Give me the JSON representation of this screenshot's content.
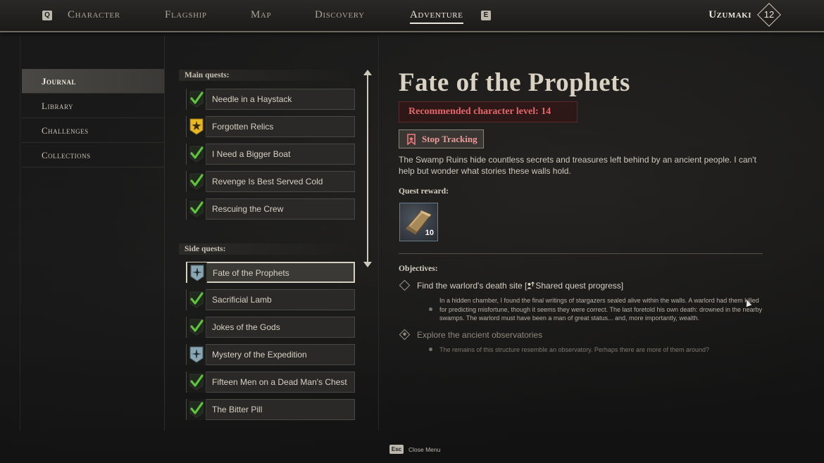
{
  "nav": {
    "left_key": "Q",
    "right_key": "E",
    "items": [
      {
        "label": "Character"
      },
      {
        "label": "Flagship"
      },
      {
        "label": "Map"
      },
      {
        "label": "Discovery"
      },
      {
        "label": "Adventure"
      }
    ],
    "active": "Adventure",
    "username": "Uzumaki",
    "level": "12"
  },
  "categories": {
    "items": [
      "Journal",
      "Library",
      "Challenges",
      "Collections"
    ],
    "active": "Journal"
  },
  "quests": {
    "main_label": "Main quests:",
    "main": [
      {
        "label": "Needle in a Haystack",
        "icon": "checkmark-icon"
      },
      {
        "label": "Forgotten Relics",
        "icon": "gold-star-icon"
      },
      {
        "label": "I Need a Bigger Boat",
        "icon": "checkmark-icon"
      },
      {
        "label": "Revenge Is Best Served Cold",
        "icon": "checkmark-icon"
      },
      {
        "label": "Rescuing the Crew",
        "icon": "checkmark-icon"
      }
    ],
    "side_label": "Side quests:",
    "side": [
      {
        "label": "Fate of the Prophets",
        "icon": "compass-star-icon"
      },
      {
        "label": "Sacrificial Lamb",
        "icon": "checkmark-icon"
      },
      {
        "label": "Jokes of the Gods",
        "icon": "checkmark-icon"
      },
      {
        "label": "Mystery of the Expedition",
        "icon": "compass-star-icon"
      },
      {
        "label": "Fifteen Men on a Dead Man's Chest",
        "icon": "checkmark-icon"
      },
      {
        "label": "The Bitter Pill",
        "icon": "checkmark-icon"
      }
    ],
    "selected": "Fate of the Prophets"
  },
  "detail": {
    "title": "Fate of the Prophets",
    "recommended_level": "Recommended character level: 14",
    "track_label": "Stop Tracking",
    "description": "The Swamp Ruins hide countless secrets and treasures left behind by an ancient people. I can't help but wonder what stories these walls hold.",
    "reward_label": "Quest reward:",
    "reward_qty": "10",
    "reward_icon": "gold-bar-icon",
    "objectives_label": "Objectives:",
    "objectives": [
      {
        "title_prefix": "Find the warlord's death site [",
        "title_shared": "Shared quest progress]",
        "note": "In a hidden chamber, I found the final writings of stargazers sealed alive within the walls. A warlord had them killed for predicting misfortune, though it seems they were correct. The last foretold his own death: drowned in the nearby swamps. The warlord must have been a man of great status... and, more importantly, wealth."
      },
      {
        "title": "Explore the ancient observatories",
        "note": "The remains of this structure resemble an observatory. Perhaps there are more of them around?"
      }
    ]
  },
  "footer": {
    "esc_key": "Esc",
    "close_label": "Close Menu"
  },
  "colors": {
    "recommended_text": "#e5676b",
    "checkmark": "#5fc43a",
    "gold_star": "#e8b824",
    "compass_badge": "#8aa6b3"
  }
}
